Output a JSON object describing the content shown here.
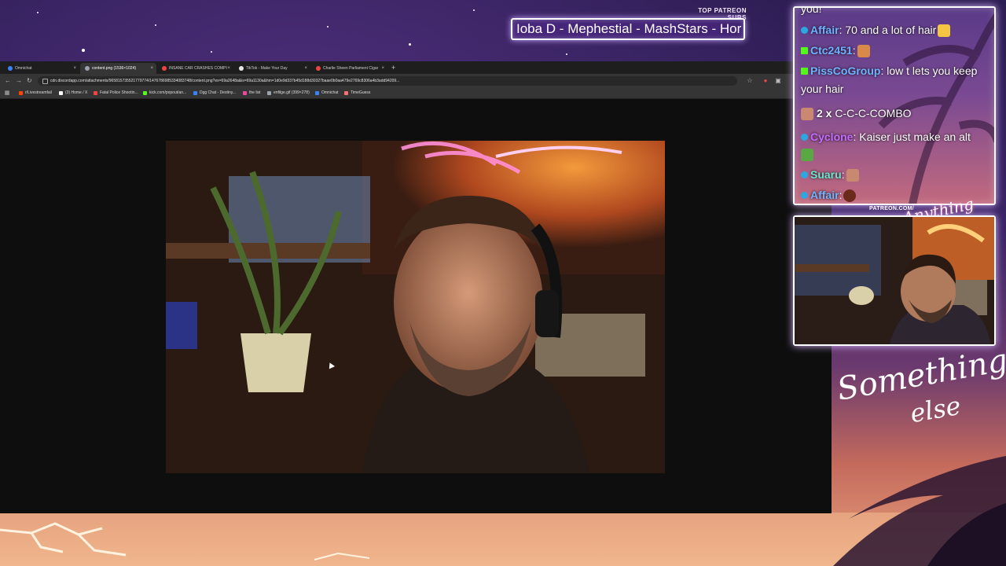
{
  "overlay": {
    "patreon_header": "TOP PATREON SUBS",
    "patreon_ticker": "Ioba D - Mephestial - MashStars - Hor",
    "patreon_url": "PATREON.COM/",
    "brand_small": "Anything else",
    "brand_large_line1": "Something",
    "brand_large_line2": "else"
  },
  "browser": {
    "tabs": [
      {
        "label": "Omnichat",
        "favicon": "chat-icon",
        "color": "#3b82f6"
      },
      {
        "label": "content.png (1536×1024)",
        "favicon": "globe-icon",
        "color": "#9ca3af",
        "active": true
      },
      {
        "label": "INSANE CAR CRASHES COMPI",
        "favicon": "youtube-icon",
        "color": "#ef4444"
      },
      {
        "label": "TikTok - Make Your Day",
        "favicon": "tiktok-icon",
        "color": "#e5e7eb"
      },
      {
        "label": "Charlie Sheen Parliament Cigar",
        "favicon": "youtube-icon",
        "color": "#ef4444"
      }
    ],
    "new_tab": "+",
    "url": "cdn.discordapp.com/attachments/965815735521779774/1476786985334083748/content.png?ex=69a2648a&is=69a1130a&hm=1d0e9d337b45d188d30327baae0b0aa479e2769c8306a4b3add94209...",
    "bookmarks": [
      {
        "label": "r/Livestreamfail",
        "color": "#ff4500"
      },
      {
        "label": "(3) Home / X",
        "color": "#ffffff"
      },
      {
        "label": "Fatal Police Shootin...",
        "color": "#ef4444"
      },
      {
        "label": "kick.com/popout/an...",
        "color": "#53fc18"
      },
      {
        "label": "Dgg Chat - Destiny...",
        "color": "#3b82f6"
      },
      {
        "label": "the list",
        "color": "#ec4899"
      },
      {
        "label": "enfilge.gif (399×278)",
        "color": "#9ca3af"
      },
      {
        "label": "Omnichat",
        "color": "#3b82f6"
      },
      {
        "label": "TimeGuess",
        "color": "#f87171"
      }
    ]
  },
  "chat": {
    "messages": [
      {
        "top": "you!",
        "user": "",
        "text": "",
        "badge": "none"
      },
      {
        "user": "Affair",
        "user_color": "#6fb3ff",
        "text": ": 70 and a lot of hair",
        "badge": "twitch",
        "emote": true
      },
      {
        "user": "Ctc2451",
        "user_color": "#6fb3ff",
        "text": ":",
        "badge": "kick",
        "emote": true
      },
      {
        "user": "PissCoGroup",
        "user_color": "#6fb3ff",
        "text": ": low t lets you keep",
        "badge": "kick"
      },
      {
        "user": "",
        "text": "your hair",
        "badge": "none"
      },
      {
        "user": "2 x",
        "user_color": "#ffffff",
        "text": " C-C-C-COMBO",
        "badge": "none",
        "emote": true
      },
      {
        "user": "Cyclone",
        "user_color": "#c46cff",
        "text": ": Kaiser just make an alt",
        "badge": "twitch"
      },
      {
        "user": "Suaru",
        "user_color": "#6fe3d0",
        "text": ":",
        "badge": "twitch",
        "emote": true
      },
      {
        "user": "Affair",
        "user_color": "#6fb3ff",
        "text": ":",
        "badge": "twitch",
        "emote": true
      }
    ]
  }
}
